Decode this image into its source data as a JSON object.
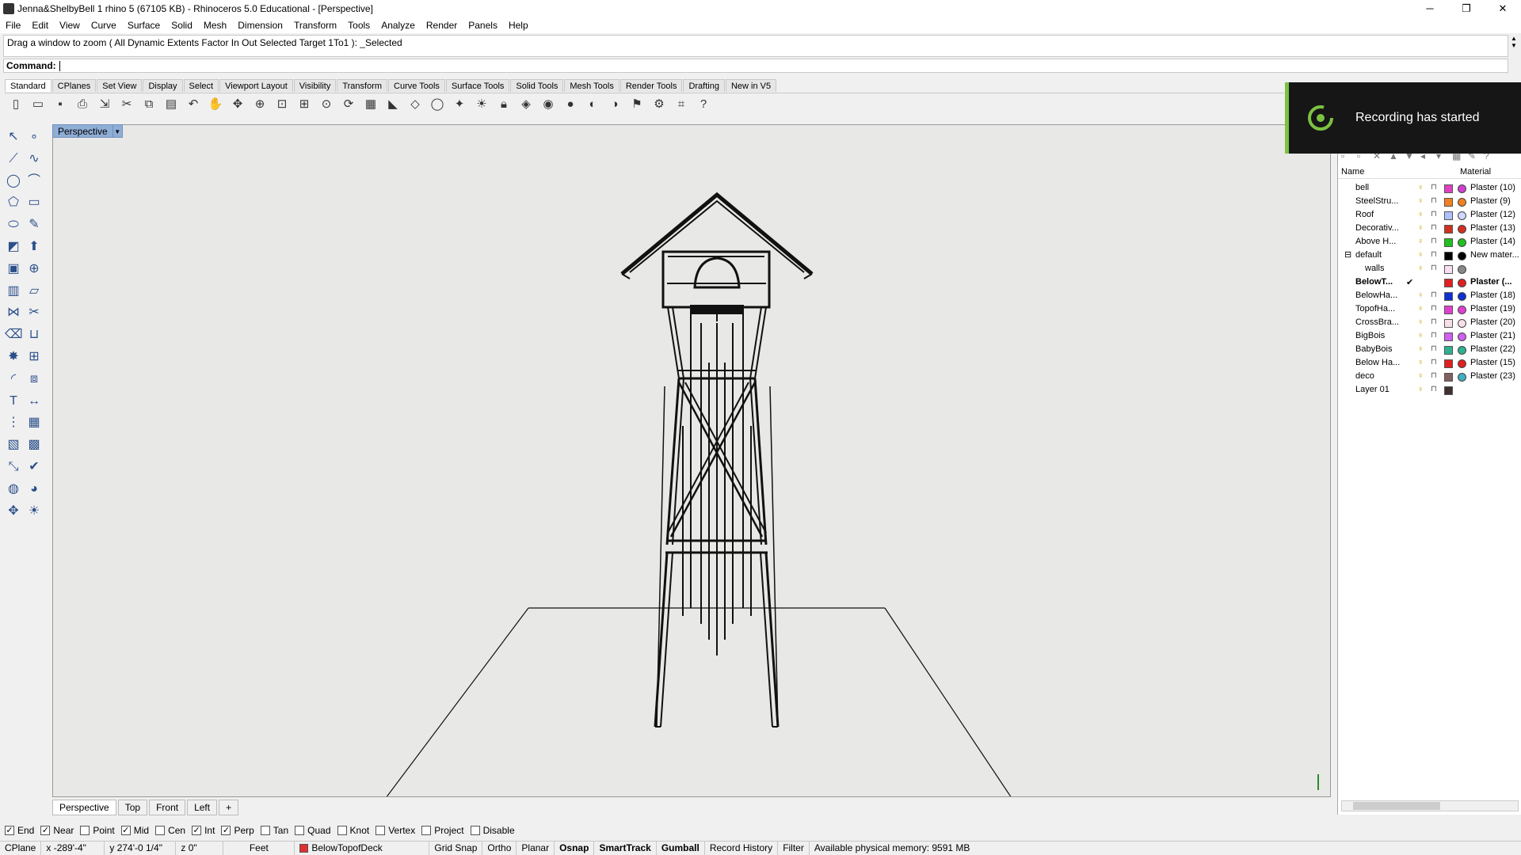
{
  "window": {
    "title": "Jenna&ShelbyBell 1 rhino 5 (67105 KB) - Rhinoceros 5.0 Educational - [Perspective]",
    "minimize": "─",
    "maximize": "❐",
    "close": "✕"
  },
  "menu": [
    "File",
    "Edit",
    "View",
    "Curve",
    "Surface",
    "Solid",
    "Mesh",
    "Dimension",
    "Transform",
    "Tools",
    "Analyze",
    "Render",
    "Panels",
    "Help"
  ],
  "command": {
    "history": "Drag a window to zoom ( All  Dynamic  Extents  Factor  In  Out  Selected  Target  1To1 ): _Selected",
    "label": "Command:",
    "value": ""
  },
  "toolbar_tabs": [
    "Standard",
    "CPlanes",
    "Set View",
    "Display",
    "Select",
    "Viewport Layout",
    "Visibility",
    "Transform",
    "Curve Tools",
    "Surface Tools",
    "Solid Tools",
    "Mesh Tools",
    "Render Tools",
    "Drafting",
    "New in V5"
  ],
  "active_toolbar_tab": "Standard",
  "toolbar_icons": [
    "new-icon",
    "open-icon",
    "save-icon",
    "print-icon",
    "import-icon",
    "cut-icon",
    "copy-icon",
    "paste-icon",
    "undo-icon",
    "pan-icon",
    "move-icon",
    "zoom-in-icon",
    "zoom-extents-icon",
    "zoom-window-icon",
    "zoom-selected-icon",
    "rotate-view-icon",
    "four-viewports-icon",
    "car-icon",
    "cplane-icon",
    "circle-icon",
    "point-icon",
    "light-icon",
    "lock-icon",
    "material-icon",
    "color-icon",
    "sphere-icon",
    "render-icon",
    "render-preview-icon",
    "flag-icon",
    "gear-icon",
    "grid-icon",
    "help-icon"
  ],
  "viewport": {
    "name": "Perspective",
    "tabs": [
      "Perspective",
      "Top",
      "Front",
      "Left"
    ],
    "add_tab": "+"
  },
  "osnaps": [
    {
      "label": "End",
      "checked": true
    },
    {
      "label": "Near",
      "checked": true
    },
    {
      "label": "Point",
      "checked": false
    },
    {
      "label": "Mid",
      "checked": true
    },
    {
      "label": "Cen",
      "checked": false
    },
    {
      "label": "Int",
      "checked": true
    },
    {
      "label": "Perp",
      "checked": true
    },
    {
      "label": "Tan",
      "checked": false
    },
    {
      "label": "Quad",
      "checked": false
    },
    {
      "label": "Knot",
      "checked": false
    },
    {
      "label": "Vertex",
      "checked": false
    },
    {
      "label": "Project",
      "checked": false
    },
    {
      "label": "Disable",
      "checked": false
    }
  ],
  "status": {
    "cplane": "CPlane",
    "x": "x -289'-4\"",
    "y": "y 274'-0 1/4\"",
    "z": "z 0\"",
    "units": "Feet",
    "layer": "BelowTopofDeck",
    "layer_color": "#e03030",
    "grid_snap": "Grid Snap",
    "ortho": "Ortho",
    "planar": "Planar",
    "osnap": "Osnap",
    "smarttrack": "SmartTrack",
    "gumball": "Gumball",
    "record_history": "Record History",
    "filter": "Filter",
    "memory": "Available physical memory: 9591 MB"
  },
  "layers": {
    "col_name": "Name",
    "col_material": "Material",
    "rows": [
      {
        "name": "bell",
        "color": "#e040c0",
        "matcolor": "#d040d0",
        "material": "Plaster (10)",
        "indent": 0
      },
      {
        "name": "SteelStru...",
        "color": "#f08020",
        "matcolor": "#f08020",
        "material": "Plaster (9)",
        "indent": 0
      },
      {
        "name": "Roof",
        "color": "#b0c0ff",
        "matcolor": "#d0d8ff",
        "material": "Plaster (12)",
        "indent": 0
      },
      {
        "name": "Decorativ...",
        "color": "#d03020",
        "matcolor": "#d03020",
        "material": "Plaster (13)",
        "indent": 0
      },
      {
        "name": "Above H...",
        "color": "#20c020",
        "matcolor": "#20c020",
        "material": "Plaster (14)",
        "indent": 0
      },
      {
        "name": "default",
        "color": "#000000",
        "matcolor": "#000000",
        "material": "New mater...",
        "indent": 0,
        "expander": "⊟"
      },
      {
        "name": "walls",
        "color": "#f8e0f0",
        "matcolor": "#888888",
        "material": "",
        "indent": 1
      },
      {
        "name": "BelowT...",
        "color": "#e02020",
        "matcolor": "#e02020",
        "material": "Plaster (...",
        "indent": 0,
        "current": true,
        "check": "✔"
      },
      {
        "name": "BelowHa...",
        "color": "#1030d0",
        "matcolor": "#1030d0",
        "material": "Plaster (18)",
        "indent": 0
      },
      {
        "name": "TopofHa...",
        "color": "#e040d0",
        "matcolor": "#e040d0",
        "material": "Plaster (19)",
        "indent": 0
      },
      {
        "name": "CrossBra...",
        "color": "#f8e0e8",
        "matcolor": "#f8e0e8",
        "material": "Plaster (20)",
        "indent": 0
      },
      {
        "name": "BigBois",
        "color": "#d060f0",
        "matcolor": "#d060f0",
        "material": "Plaster (21)",
        "indent": 0
      },
      {
        "name": "BabyBois",
        "color": "#30b090",
        "matcolor": "#30b090",
        "material": "Plaster (22)",
        "indent": 0
      },
      {
        "name": "Below Ha...",
        "color": "#e02020",
        "matcolor": "#e02020",
        "material": "Plaster (15)",
        "indent": 0
      },
      {
        "name": "deco",
        "color": "#806060",
        "matcolor": "#40b0c0",
        "material": "Plaster (23)",
        "indent": 0
      },
      {
        "name": "Layer 01",
        "color": "#403030",
        "matcolor": "",
        "material": "",
        "indent": 0
      }
    ]
  },
  "toast": {
    "message": "Recording has started",
    "accent": "#7cc242"
  }
}
